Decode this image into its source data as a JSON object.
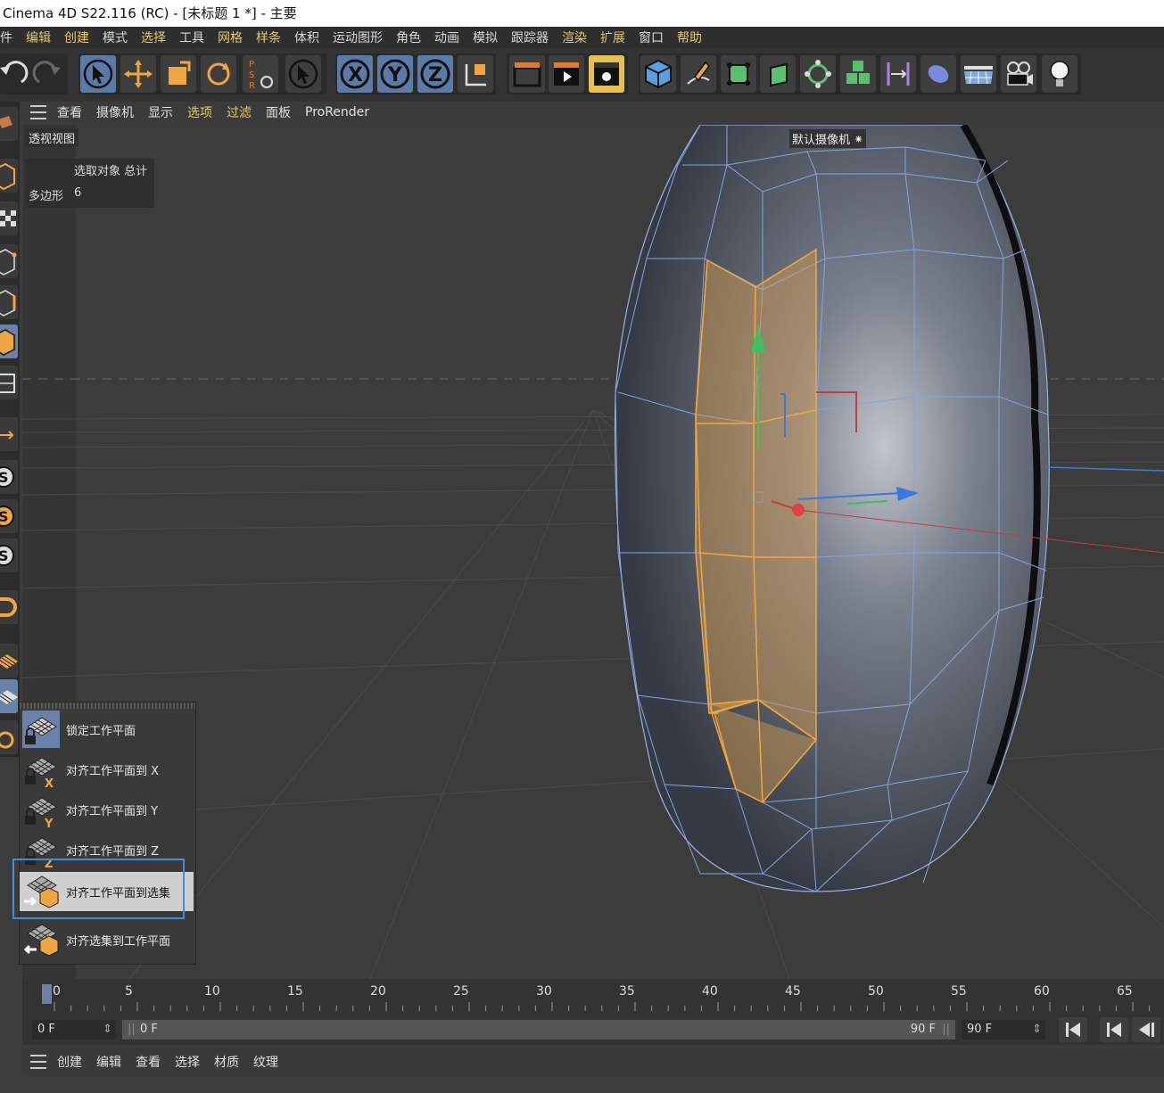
{
  "window": {
    "title": "Cinema 4D S22.116 (RC) - [未标题 1 *] - 主要"
  },
  "menu": [
    "件",
    "编辑",
    "创建",
    "模式",
    "选择",
    "工具",
    "网格",
    "样条",
    "体积",
    "运动图形",
    "角色",
    "动画",
    "模拟",
    "跟踪器",
    "渲染",
    "扩展",
    "窗口",
    "帮助"
  ],
  "viewport_menu": [
    "查看",
    "摄像机",
    "显示",
    "选项",
    "过滤",
    "面板",
    "ProRender"
  ],
  "viewport": {
    "label": "透视视图",
    "camera_label": "默认摄像机",
    "hud": {
      "header": "选取对象 总计",
      "row_label": "多边形",
      "row_value": "6"
    }
  },
  "popup_menu": {
    "items": [
      {
        "label": "锁定工作平面",
        "icon": "lock-workplane-icon"
      },
      {
        "label": "对齐工作平面到 X",
        "icon": "align-workplane-x-icon"
      },
      {
        "label": "对齐工作平面到 Y",
        "icon": "align-workplane-y-icon"
      },
      {
        "label": "对齐工作平面到 Z",
        "icon": "align-workplane-z-icon"
      },
      {
        "label": "对齐工作平面到选集",
        "icon": "align-workplane-selection-icon"
      },
      {
        "label": "对齐选集到工作平面",
        "icon": "align-selection-workplane-icon"
      }
    ],
    "selected_index": 4
  },
  "timeline": {
    "ticks": [
      "0",
      "5",
      "10",
      "15",
      "20",
      "25",
      "30",
      "35",
      "40",
      "45",
      "50",
      "55",
      "60",
      "65"
    ],
    "current_frame": "0 F",
    "range_start": "0 F",
    "range_end": "90 F",
    "end_frame": "90 F"
  },
  "material_menu": [
    "创建",
    "编辑",
    "查看",
    "选择",
    "材质",
    "纹理"
  ],
  "colors": {
    "accent": "#e6c86a",
    "selection": "#f0a640",
    "highlight_box": "#3e8fd8",
    "active_tool": "#5a7aa8"
  }
}
